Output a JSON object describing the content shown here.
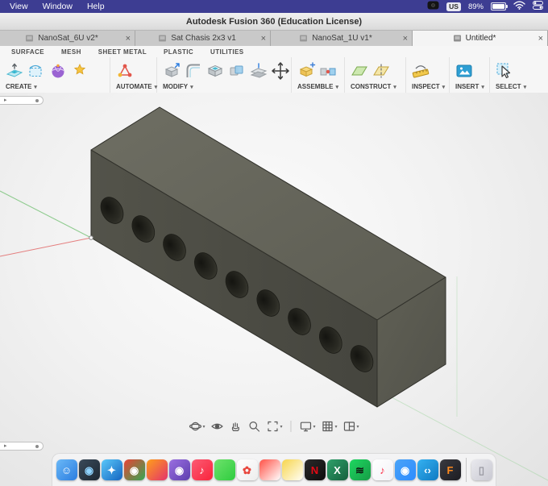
{
  "menubar": {
    "items": [
      {
        "label": "View"
      },
      {
        "label": "Window"
      },
      {
        "label": "Help"
      }
    ],
    "status": {
      "keyboard_layout": "US",
      "battery_percent": "89%"
    },
    "bar_color": "#3d3d92"
  },
  "titlebar": {
    "title": "Autodesk Fusion 360 (Education License)"
  },
  "doc_tabs": {
    "close_glyph": "×",
    "tabs": [
      {
        "title": "NanoSat_6U v2*",
        "active": false
      },
      {
        "title": "Sat Chasis 2x3 v1",
        "active": false
      },
      {
        "title": "NanoSat_1U v1*",
        "active": false
      },
      {
        "title": "Untitled*",
        "active": true
      }
    ]
  },
  "workspace_tabs": {
    "tabs": [
      {
        "label": "SURFACE"
      },
      {
        "label": "MESH"
      },
      {
        "label": "SHEET METAL"
      },
      {
        "label": "PLASTIC"
      },
      {
        "label": "UTILITIES"
      }
    ]
  },
  "ribbon": {
    "caret": "▾",
    "groups": [
      {
        "label": "CREATE"
      },
      {
        "label": "AUTOMATE"
      },
      {
        "label": "MODIFY"
      },
      {
        "label": "ASSEMBLE"
      },
      {
        "label": "CONSTRUCT"
      },
      {
        "label": "INSPECT"
      },
      {
        "label": "INSERT"
      },
      {
        "label": "SELECT"
      }
    ]
  },
  "canvas": {
    "nav_bar": {
      "caret": "▾",
      "buttons": [
        {
          "name": "orbit",
          "dropdown": true
        },
        {
          "name": "look-at",
          "dropdown": false
        },
        {
          "name": "pan",
          "dropdown": false
        },
        {
          "name": "zoom",
          "dropdown": false
        },
        {
          "name": "fit",
          "dropdown": true
        },
        {
          "name": "display-settings",
          "dropdown": true,
          "divider_before": true
        },
        {
          "name": "grid-settings",
          "dropdown": true
        },
        {
          "name": "viewports",
          "dropdown": true
        }
      ]
    },
    "model_colors": {
      "top": "#66665c",
      "front": "#4c4c44",
      "right": "#57574f",
      "hole": "#1c1c17"
    }
  },
  "dock": {
    "apps": [
      {
        "name": "finder",
        "c1": "#6ab8f7",
        "c2": "#2b7de0",
        "glyph": "☺",
        "gc": "#ffffff"
      },
      {
        "name": "photo-booth",
        "c1": "#3a4a5a",
        "c2": "#1d2833",
        "glyph": "◉",
        "gc": "#8fd4ff"
      },
      {
        "name": "safari",
        "c1": "#5ac8fa",
        "c2": "#1565c0",
        "glyph": "✦",
        "gc": "#ffffff"
      },
      {
        "name": "chrome",
        "c1": "#ea4335",
        "c2": "#34a853",
        "glyph": "◉",
        "gc": "#ffffff"
      },
      {
        "name": "firefox",
        "c1": "#ff9f1a",
        "c2": "#e3336d",
        "glyph": "",
        "gc": "#ffffff"
      },
      {
        "name": "podcasts",
        "c1": "#9a6ee0",
        "c2": "#5d3fae",
        "glyph": "◉",
        "gc": "#ffffff"
      },
      {
        "name": "music",
        "c1": "#fb5c74",
        "c2": "#fa233b",
        "glyph": "♪",
        "gc": "#ffffff"
      },
      {
        "name": "messages",
        "c1": "#6de26b",
        "c2": "#2fcc3f",
        "glyph": "",
        "gc": "#ffffff"
      },
      {
        "name": "photos",
        "c1": "#ffffff",
        "c2": "#ededed",
        "glyph": "✿",
        "gc": "#e8453c"
      },
      {
        "name": "calendar",
        "c1": "#ff5146",
        "c2": "#ffffff",
        "glyph": "",
        "gc": "#333333"
      },
      {
        "name": "notes",
        "c1": "#f7d54c",
        "c2": "#fffef5",
        "glyph": "",
        "gc": "#333333"
      },
      {
        "name": "netflix",
        "c1": "#2a2a2a",
        "c2": "#0d0d0d",
        "glyph": "N",
        "gc": "#e50914"
      },
      {
        "name": "excel",
        "c1": "#2ea06a",
        "c2": "#15603d",
        "glyph": "X",
        "gc": "#ffffff"
      },
      {
        "name": "spotify",
        "c1": "#1ed760",
        "c2": "#169c46",
        "glyph": "≋",
        "gc": "#0d130f"
      },
      {
        "name": "apple-music",
        "c1": "#ffffff",
        "c2": "#f2f2f7",
        "glyph": "♪",
        "gc": "#fa2d48"
      },
      {
        "name": "zoom",
        "c1": "#4aa3f7",
        "c2": "#2d8cff",
        "glyph": "◉",
        "gc": "#ffffff"
      },
      {
        "name": "vscode",
        "c1": "#35b1f1",
        "c2": "#0f7ac2",
        "glyph": "‹›",
        "gc": "#ffffff"
      },
      {
        "name": "fusion-360",
        "c1": "#3a3a40",
        "c2": "#1c1c22",
        "glyph": "F",
        "gc": "#ff8a1e"
      },
      {
        "name": "trash",
        "c1": "#e9e9ee",
        "c2": "#c9c9d2",
        "glyph": "▯",
        "gc": "#9a9aa3",
        "divider_before": true
      }
    ]
  }
}
